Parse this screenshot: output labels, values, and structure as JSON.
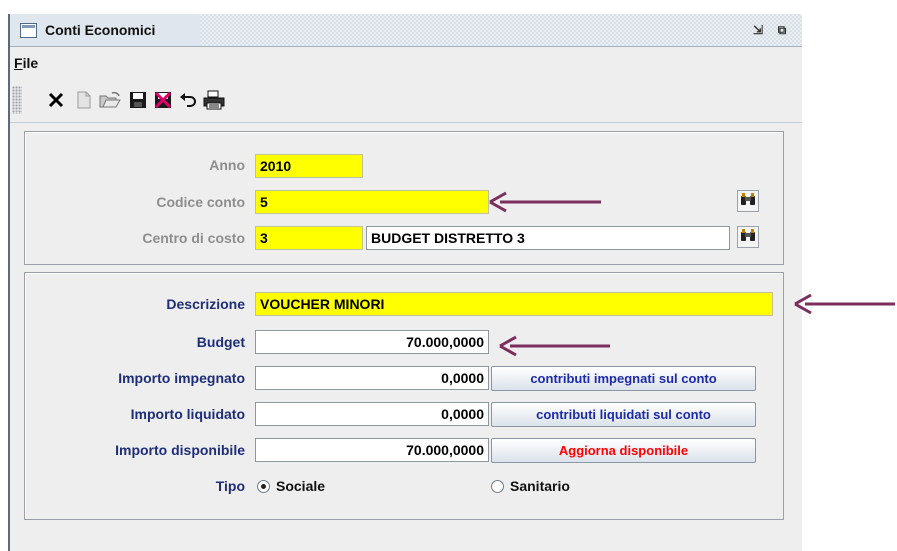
{
  "window": {
    "title": "Conti Economici",
    "restore_glyph": "⇲",
    "maximize_glyph": "⧉"
  },
  "menu": {
    "file_mnemonic": "F",
    "file_rest": "ile"
  },
  "toolbar": {
    "icons": [
      "close-x-icon",
      "new-document-icon",
      "open-folder-icon",
      "save-icon",
      "delete-icon",
      "undo-icon",
      "print-icon"
    ]
  },
  "header_panel": {
    "anno_label": "Anno",
    "anno_value": "2010",
    "codice_conto_label": "Codice conto",
    "codice_conto_value": "5",
    "centro_costo_label": "Centro di costo",
    "centro_costo_code": "3",
    "centro_costo_desc": "BUDGET DISTRETTO 3"
  },
  "detail_panel": {
    "descrizione_label": "Descrizione",
    "descrizione_value": "VOUCHER MINORI",
    "budget_label": "Budget",
    "budget_value": "70.000,0000",
    "impegnato_label": "Importo impegnato",
    "impegnato_value": "0,0000",
    "impegnato_button": "contributi impegnati sul conto",
    "liquidato_label": "Importo liquidato",
    "liquidato_value": "0,0000",
    "liquidato_button": "contributi liquidati sul conto",
    "disponibile_label": "Importo disponibile",
    "disponibile_value": "70.000,0000",
    "disponibile_button": "Aggiorna disponibile",
    "tipo_label": "Tipo",
    "tipo_options": [
      "Sociale",
      "Sanitario"
    ],
    "tipo_selected": "Sociale"
  },
  "colors": {
    "required_field": "#ffff00",
    "label_blue": "#1e2d78",
    "button_text_blue": "#1c2ba8",
    "button_text_red": "#ff0000",
    "annotation_arrow": "#7b2d5e"
  }
}
